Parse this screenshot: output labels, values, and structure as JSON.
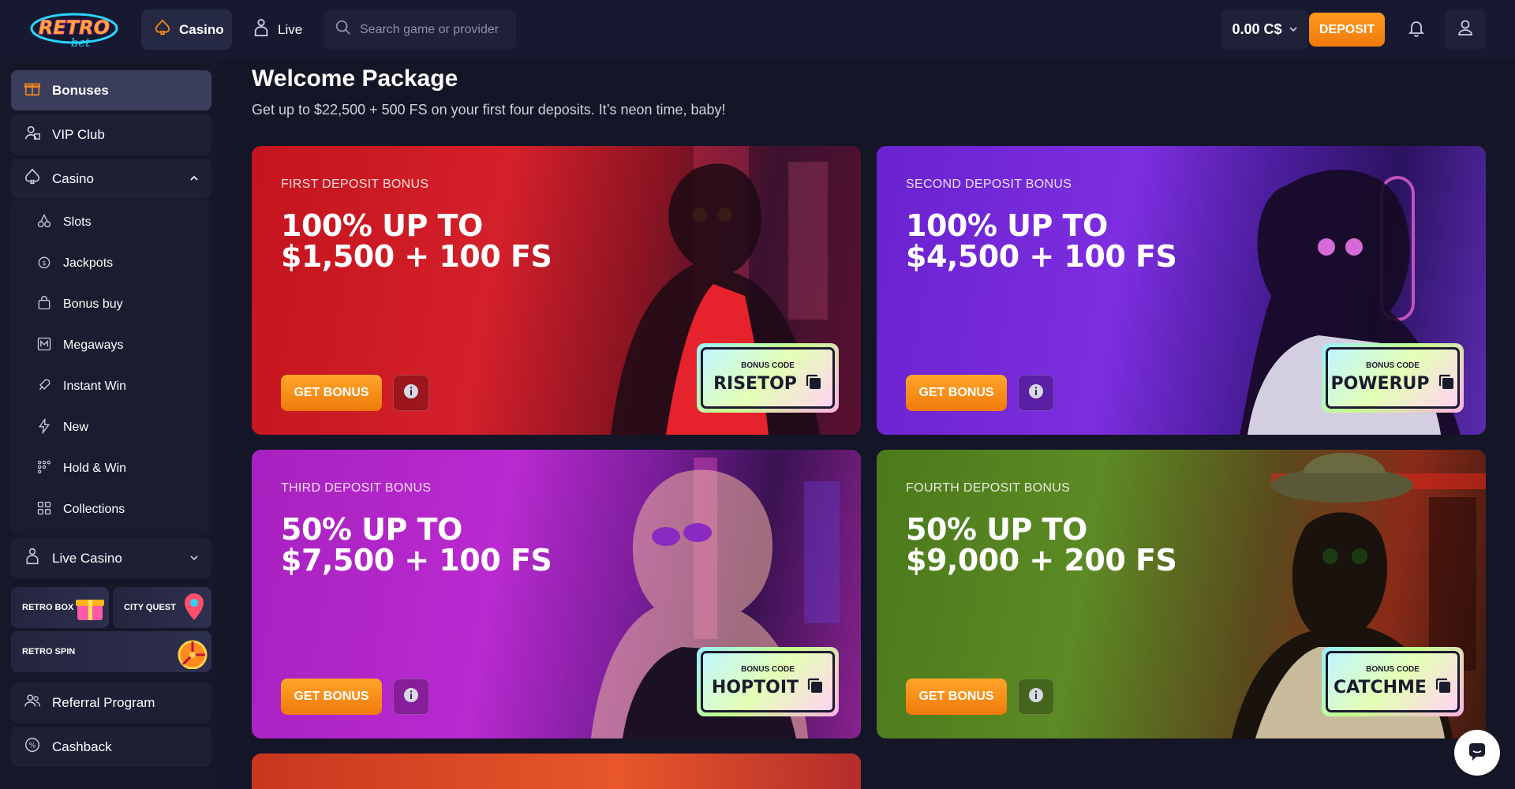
{
  "header": {
    "logo_text": "RETRO",
    "logo_sub": "bet",
    "tabs": [
      {
        "label": "Casino",
        "icon": "spade-icon"
      },
      {
        "label": "Live",
        "icon": "dealer-icon"
      }
    ],
    "search_placeholder": "Search game or provider",
    "balance": "0.00 C$",
    "deposit_label": "DEPOSIT"
  },
  "sidebar": {
    "top_items": [
      {
        "label": "Bonuses",
        "icon": "gift-icon",
        "active": true
      },
      {
        "label": "VIP Club",
        "icon": "vip-icon"
      }
    ],
    "casino_label": "Casino",
    "casino_items": [
      {
        "label": "Slots",
        "icon": "cherry-icon"
      },
      {
        "label": "Jackpots",
        "icon": "coin-icon"
      },
      {
        "label": "Bonus buy",
        "icon": "bag-icon"
      },
      {
        "label": "Megaways",
        "icon": "megaways-icon"
      },
      {
        "label": "Instant Win",
        "icon": "rocket-icon"
      },
      {
        "label": "New",
        "icon": "bolt-icon"
      },
      {
        "label": "Hold & Win",
        "icon": "dots-icon"
      },
      {
        "label": "Collections",
        "icon": "grid-icon"
      }
    ],
    "live_casino_label": "Live Casino",
    "promos": [
      "RETRO BOX",
      "CITY QUEST",
      "RETRO SPIN"
    ],
    "bottom_items": [
      {
        "label": "Referral Program",
        "icon": "users-icon"
      },
      {
        "label": "Cashback",
        "icon": "cashback-icon"
      }
    ]
  },
  "main": {
    "title": "Welcome Package",
    "subtitle": "Get up to $22,500 + 500 FS on your first four deposits. It’s neon time, baby!",
    "cards": [
      {
        "label": "FIRST DEPOSIT BONUS",
        "line1": "100% UP TO",
        "line2": "$1,500 + 100 FS",
        "button": "GET BONUS",
        "code_caption": "BONUS CODE",
        "code": "RISETOP"
      },
      {
        "label": "SECOND DEPOSIT BONUS",
        "line1": "100% UP TO",
        "line2": "$4,500 + 100 FS",
        "button": "GET BONUS",
        "code_caption": "BONUS CODE",
        "code": "POWERUP"
      },
      {
        "label": "THIRD DEPOSIT BONUS",
        "line1": "50% UP TO",
        "line2": "$7,500 + 100 FS",
        "button": "GET BONUS",
        "code_caption": "BONUS CODE",
        "code": "HOPTOIT"
      },
      {
        "label": "FOURTH DEPOSIT BONUS",
        "line1": "50% UP TO",
        "line2": "$9,000 + 200 FS",
        "button": "GET BONUS",
        "code_caption": "BONUS CODE",
        "code": "CATCHME"
      }
    ]
  },
  "colors": {
    "accent": "#f5871a",
    "background": "#141527",
    "card1": "#c8181e",
    "card2": "#7a2ad6",
    "card3": "#b825c8",
    "card4": "#4f7a1e"
  }
}
